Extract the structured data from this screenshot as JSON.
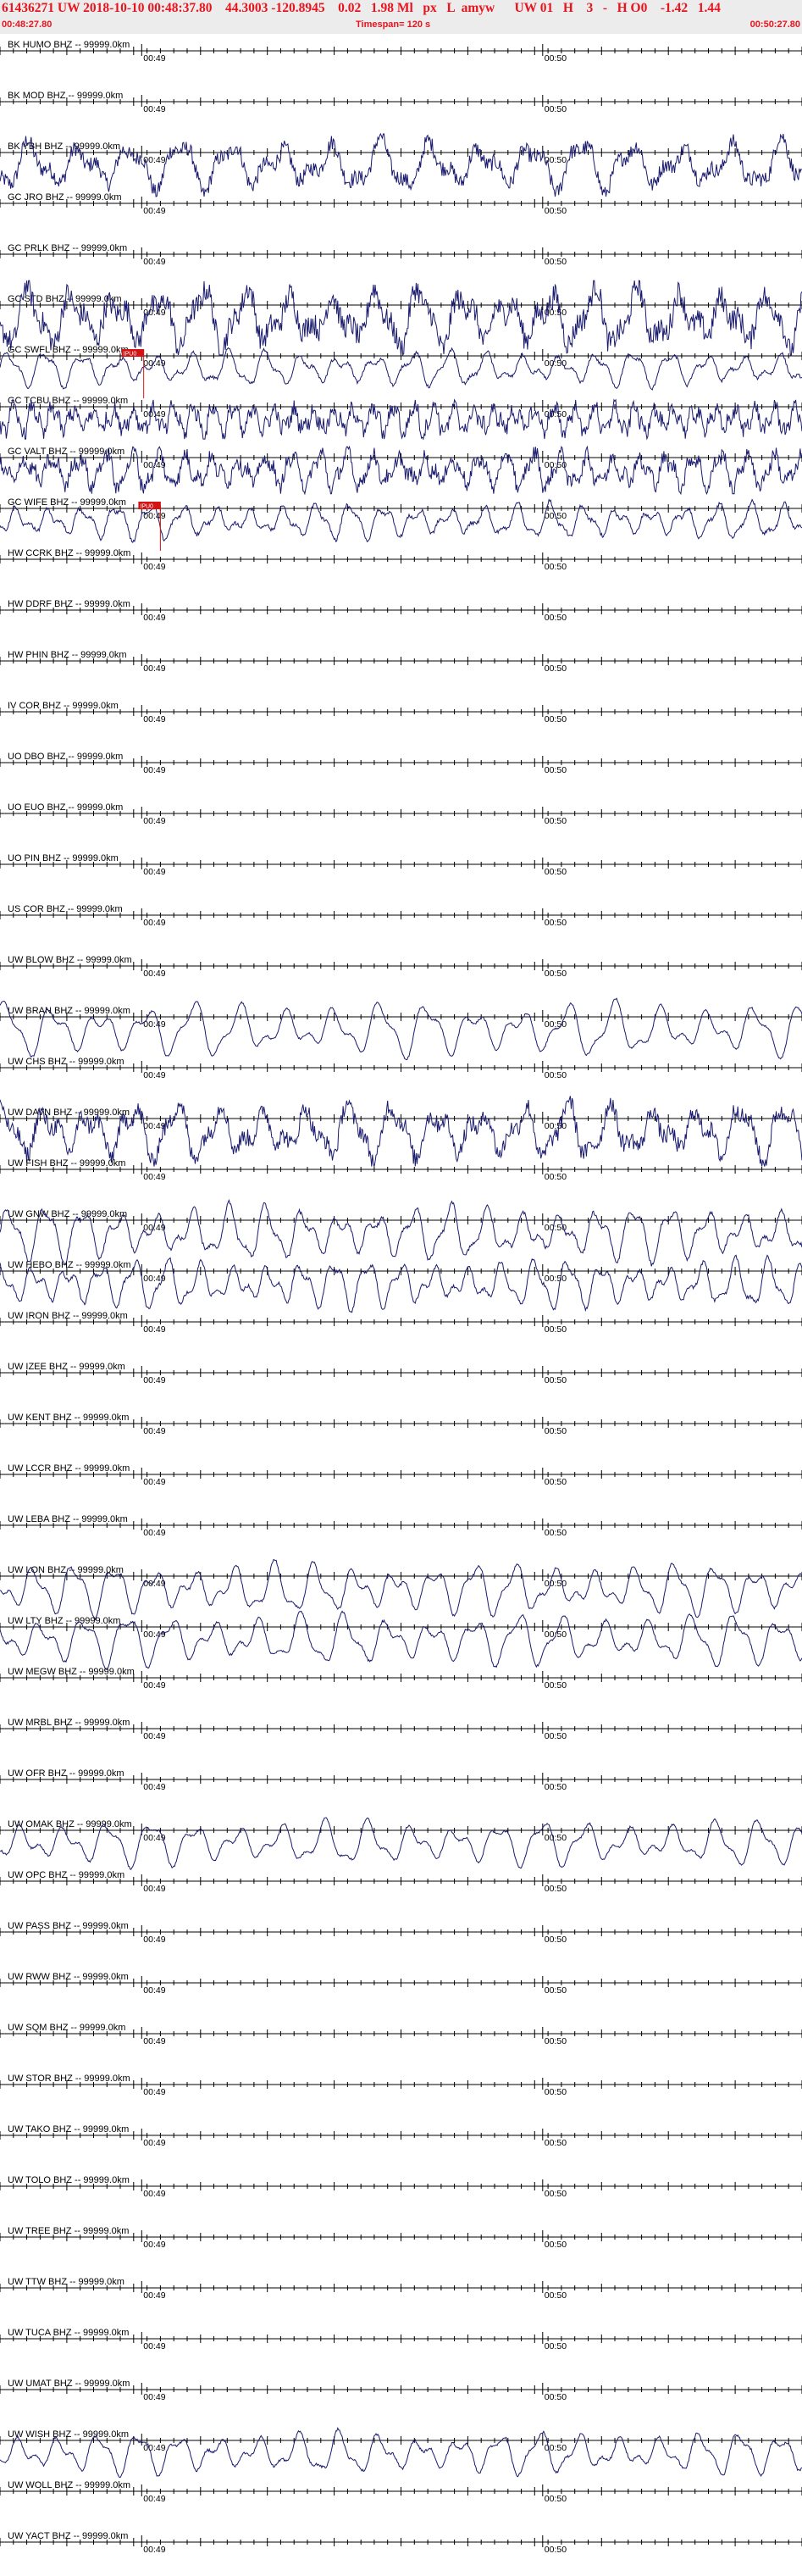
{
  "header": {
    "title": "61436271 UW 2018-10-10 00:48:37.80    44.3003 -120.8945    0.02   1.98 Ml   px   L  amyw      UW 01   H    3   -   H O0    -1.42   1.44",
    "start_time": "00:48:27.80",
    "timespan": "Timespan= 120 s",
    "end_time": "00:50:27.80"
  },
  "colors": {
    "trace": "#1a1a6e",
    "axis": "#000000",
    "label": "#000000",
    "pick_box": "#d41414",
    "pick_line": "#d41414",
    "title": "#e8141e",
    "header_bg": "#ececec"
  },
  "chart_data": {
    "type": "line",
    "x_range_s": [
      0,
      120
    ],
    "time_marks": [
      {
        "t": 21.2,
        "label": "00:49"
      },
      {
        "t": 81.2,
        "label": "00:50"
      }
    ],
    "stations": [
      {
        "label": "BK HUMO BHZ -- 99999.0km",
        "amp": 0
      },
      {
        "label": "BK MOD BHZ -- 99999.0km",
        "amp": 0
      },
      {
        "label": "BK YBH BHZ -- 99999.0km",
        "amp": 0.8,
        "noise": 0.35,
        "period": 7.5
      },
      {
        "label": "GC JRO BHZ -- 99999.0km",
        "amp": 0
      },
      {
        "label": "GC PRLK BHZ -- 99999.0km",
        "amp": 0
      },
      {
        "label": "GC STD BHZ -- 99999.0km",
        "amp": 0.95,
        "noise": 0.45,
        "period": 6.5
      },
      {
        "label": "GC SWFL BHZ -- 99999.0km",
        "amp": 0.55,
        "noise": 0.1,
        "period": 5.5,
        "pick": {
          "t": 21.5,
          "label": "IPU0"
        }
      },
      {
        "label": "GC TCBU BHZ -- 99999.0km",
        "amp": 0.5,
        "noise": 0.55,
        "period": 3.0
      },
      {
        "label": "GC VALT BHZ -- 99999.0km",
        "amp": 0.6,
        "noise": 0.45,
        "period": 4.0
      },
      {
        "label": "GC WIFE BHZ -- 99999.0km",
        "amp": 0.55,
        "noise": 0.12,
        "period": 5.0,
        "pick": {
          "t": 24.0,
          "label": "IPU0"
        }
      },
      {
        "label": "HW CCRK BHZ -- 99999.0km",
        "amp": 0
      },
      {
        "label": "HW DDRF BHZ -- 99999.0km",
        "amp": 0
      },
      {
        "label": "HW PHIN BHZ -- 99999.0km",
        "amp": 0
      },
      {
        "label": "IV COR BHZ -- 99999.0km",
        "amp": 0
      },
      {
        "label": "UO DBO BHZ -- 99999.0km",
        "amp": 0
      },
      {
        "label": "UO EUO BHZ -- 99999.0km",
        "amp": 0
      },
      {
        "label": "UO PIN BHZ -- 99999.0km",
        "amp": 0
      },
      {
        "label": "US COR BHZ -- 99999.0km",
        "amp": 0
      },
      {
        "label": "UW BLOW BHZ -- 99999.0km",
        "amp": 0
      },
      {
        "label": "UW BRAN BHZ -- 99999.0km",
        "amp": 0.85,
        "noise": 0.04,
        "period": 7.0
      },
      {
        "label": "UW CHS BHZ -- 99999.0km",
        "amp": 0
      },
      {
        "label": "UW DAVN BHZ -- 99999.0km",
        "amp": 0.9,
        "noise": 0.35,
        "period": 6.5
      },
      {
        "label": "UW FISH BHZ -- 99999.0km",
        "amp": 0
      },
      {
        "label": "UW GNW BHZ -- 99999.0km",
        "amp": 0.85,
        "noise": 0.08,
        "period": 5.5
      },
      {
        "label": "UW HEBO BHZ -- 99999.0km",
        "amp": 0.75,
        "noise": 0.08,
        "period": 5.0
      },
      {
        "label": "UW IRON BHZ -- 99999.0km",
        "amp": 0
      },
      {
        "label": "UW IZEE BHZ -- 99999.0km",
        "amp": 0
      },
      {
        "label": "UW KENT BHZ -- 99999.0km",
        "amp": 0
      },
      {
        "label": "UW LCCR BHZ -- 99999.0km",
        "amp": 0
      },
      {
        "label": "UW LEBA BHZ -- 99999.0km",
        "amp": 0
      },
      {
        "label": "UW LON BHZ -- 99999.0km",
        "amp": 0.8,
        "noise": 0.05,
        "period": 6.0
      },
      {
        "label": "UW LTY BHZ -- 99999.0km",
        "amp": 0.8,
        "noise": 0.05,
        "period": 6.5
      },
      {
        "label": "UW MEGW BHZ -- 99999.0km",
        "amp": 0
      },
      {
        "label": "UW MRBL BHZ -- 99999.0km",
        "amp": 0
      },
      {
        "label": "UW OFR BHZ -- 99999.0km",
        "amp": 0
      },
      {
        "label": "UW OMAK BHZ -- 99999.0km",
        "amp": 0.7,
        "noise": 0.05,
        "period": 6.5
      },
      {
        "label": "UW OPC BHZ -- 99999.0km",
        "amp": 0
      },
      {
        "label": "UW PASS BHZ -- 99999.0km",
        "amp": 0
      },
      {
        "label": "UW RWW BHZ -- 99999.0km",
        "amp": 0
      },
      {
        "label": "UW SQM BHZ -- 99999.0km",
        "amp": 0
      },
      {
        "label": "UW STOR BHZ -- 99999.0km",
        "amp": 0
      },
      {
        "label": "UW TAKO BHZ -- 99999.0km",
        "amp": 0
      },
      {
        "label": "UW TOLO BHZ -- 99999.0km",
        "amp": 0
      },
      {
        "label": "UW TREE BHZ -- 99999.0km",
        "amp": 0
      },
      {
        "label": "UW TTW BHZ -- 99999.0km",
        "amp": 0
      },
      {
        "label": "UW TUCA BHZ -- 99999.0km",
        "amp": 0
      },
      {
        "label": "UW UMAT BHZ -- 99999.0km",
        "amp": 0
      },
      {
        "label": "UW WISH BHZ -- 99999.0km",
        "amp": 0.65,
        "noise": 0.07,
        "period": 6.0
      },
      {
        "label": "UW WOLL BHZ -- 99999.0km",
        "amp": 0
      },
      {
        "label": "UW YACT BHZ -- 99999.0km",
        "amp": 0
      }
    ]
  }
}
